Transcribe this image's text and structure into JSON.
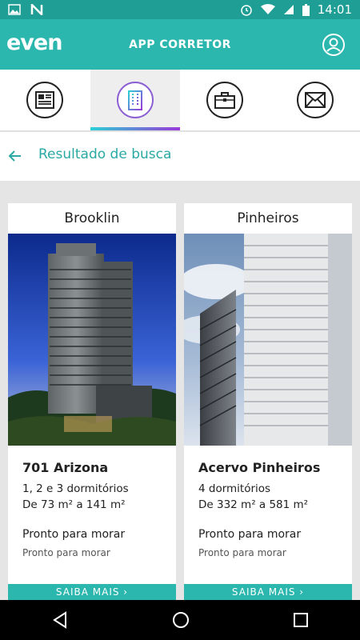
{
  "status_bar": {
    "time": "14:01",
    "icons": [
      "image-icon",
      "n-icon",
      "alarm-icon",
      "wifi-icon",
      "signal-icon",
      "battery-icon"
    ]
  },
  "app_bar": {
    "logo_text": "even",
    "title": "APP CORRETOR",
    "profile_icon": "profile-icon"
  },
  "tabs": [
    {
      "icon": "newspaper-icon",
      "active": false
    },
    {
      "icon": "building-icon",
      "active": true
    },
    {
      "icon": "briefcase-icon",
      "active": false
    },
    {
      "icon": "mail-icon",
      "active": false
    }
  ],
  "header": {
    "back_icon": "back-arrow-icon",
    "title": "Resultado de busca"
  },
  "cards": [
    {
      "neighborhood": "Brooklin",
      "name": "701 Arizona",
      "dorms": "1, 2 e 3 dormitórios",
      "area": "De 73 m² a 141 m²",
      "status": "Pronto para morar",
      "substatus": "Pronto para morar",
      "button": "SAIBA MAIS"
    },
    {
      "neighborhood": "Pinheiros",
      "name": "Acervo Pinheiros",
      "dorms": "4 dormitórios",
      "area": "De 332 m² a 581 m²",
      "status": "Pronto para morar",
      "substatus": "Pronto para morar",
      "button": "SAIBA MAIS"
    }
  ],
  "nav_bar": {
    "icons": [
      "back-nav-icon",
      "home-nav-icon",
      "recents-nav-icon"
    ]
  },
  "colors": {
    "teal": "#2bb7ae",
    "teal_dark": "#1f9e95",
    "active_tab_gradient": [
      "#2bd0d6",
      "#9a39d8"
    ]
  }
}
